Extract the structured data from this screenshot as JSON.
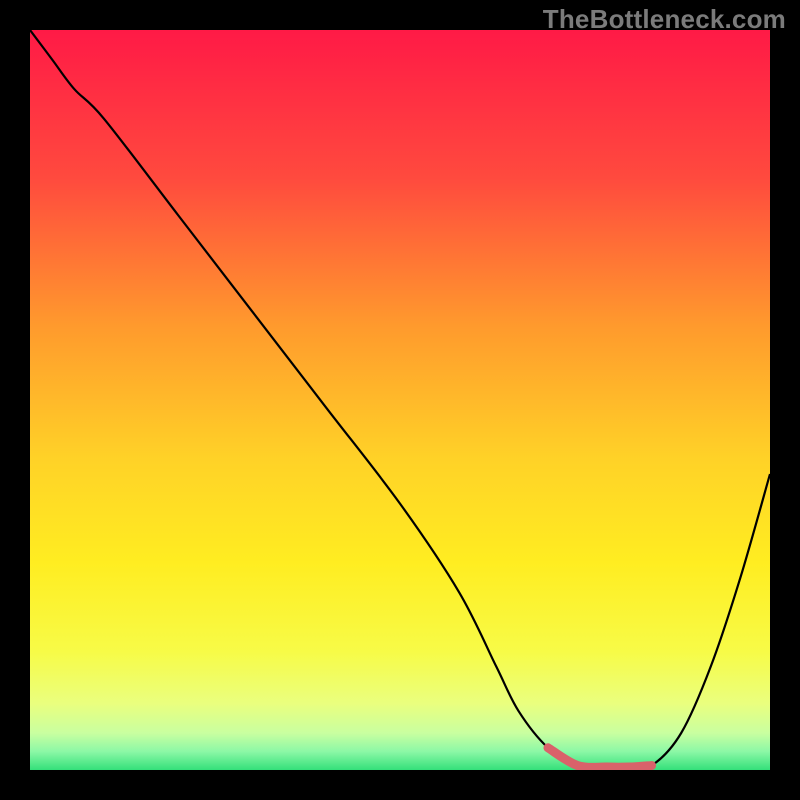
{
  "watermark": "TheBottleneck.com",
  "gradient_stops": [
    {
      "pct": 0,
      "color": "#ff1a46"
    },
    {
      "pct": 20,
      "color": "#ff4a3e"
    },
    {
      "pct": 40,
      "color": "#ff9a2d"
    },
    {
      "pct": 58,
      "color": "#ffd227"
    },
    {
      "pct": 72,
      "color": "#ffed21"
    },
    {
      "pct": 84,
      "color": "#f7fb47"
    },
    {
      "pct": 91,
      "color": "#eaff7e"
    },
    {
      "pct": 95,
      "color": "#c9ffa0"
    },
    {
      "pct": 97.5,
      "color": "#8cf8a6"
    },
    {
      "pct": 100,
      "color": "#34e07a"
    }
  ],
  "chart_data": {
    "type": "line",
    "title": "",
    "xlabel": "",
    "ylabel": "",
    "xlim": [
      0,
      100
    ],
    "ylim": [
      0,
      100
    ],
    "series": [
      {
        "name": "bottleneck-curve",
        "x": [
          0,
          3,
          6,
          10,
          20,
          30,
          40,
          50,
          58,
          63,
          66,
          70,
          74,
          78,
          81,
          84,
          88,
          92,
          96,
          100
        ],
        "values": [
          100,
          96,
          92,
          88,
          75,
          62,
          49,
          36,
          24,
          14,
          8,
          3,
          0.6,
          0.4,
          0.4,
          0.6,
          5,
          14,
          26,
          40
        ]
      },
      {
        "name": "optimal-band",
        "x": [
          70,
          74,
          78,
          81,
          84
        ],
        "values": [
          3,
          0.6,
          0.4,
          0.4,
          0.6
        ]
      }
    ],
    "annotations": {
      "optimal_band_color": "#d9626a",
      "curve_color": "#000000"
    }
  }
}
